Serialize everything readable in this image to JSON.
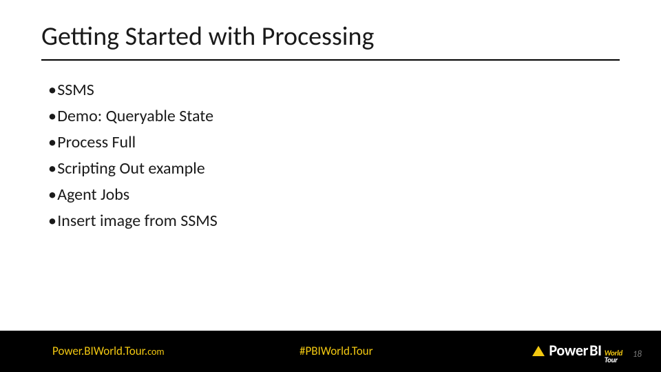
{
  "slide": {
    "title": "Getting Started with Processing",
    "bullets": [
      "SSMS",
      "Demo: Queryable State",
      "Process Full",
      "Scripting Out example",
      "Agent Jobs",
      "Insert image from SSMS"
    ]
  },
  "footer": {
    "url_main": "Power.BIWorld.Tour.",
    "url_suffix": "com",
    "hashtag": "#PBIWorld.Tour",
    "logo": {
      "word_power": "Power",
      "word_bi": "BI",
      "word_world": "World",
      "word_tour": "Tour"
    },
    "page_number": "18"
  },
  "colors": {
    "accent": "#f2c811",
    "footer_bg": "#000000",
    "text": "#1a1a1a"
  }
}
